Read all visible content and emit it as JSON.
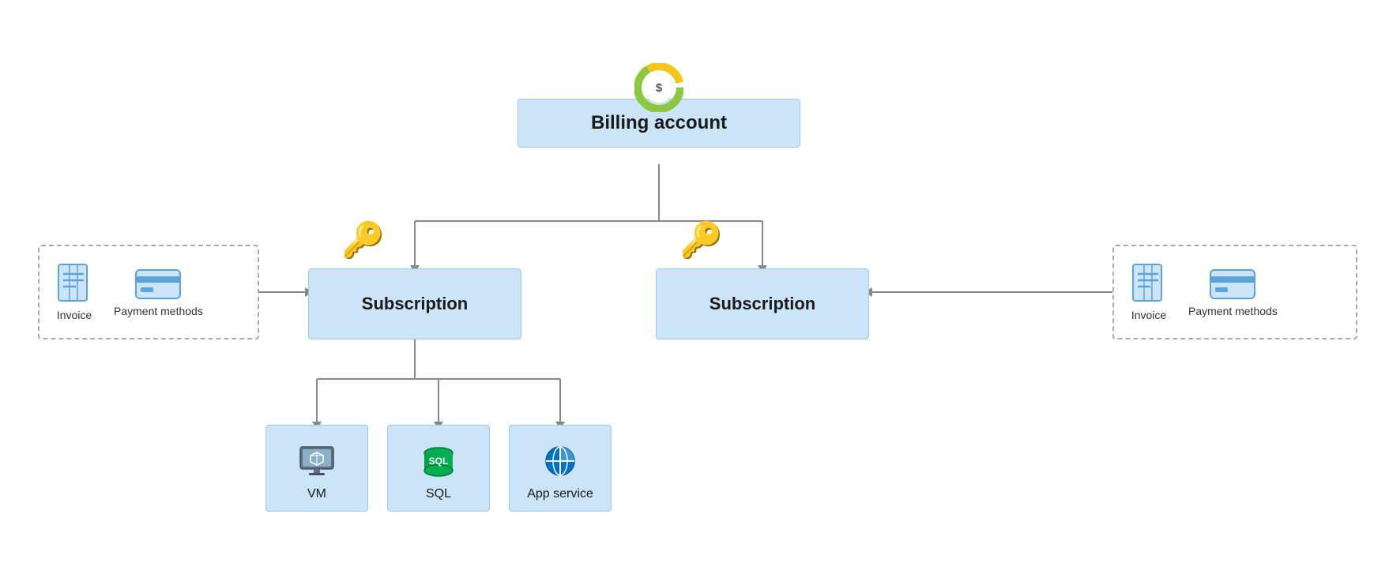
{
  "billing": {
    "label": "Billing account"
  },
  "subscriptions": {
    "left_label": "Subscription",
    "right_label": "Subscription"
  },
  "left_sidebar": {
    "invoice_label": "Invoice",
    "payment_label": "Payment methods"
  },
  "right_sidebar": {
    "invoice_label": "Invoice",
    "payment_label": "Payment methods"
  },
  "resources": {
    "vm_label": "VM",
    "sql_label": "SQL",
    "app_label": "App service"
  },
  "colors": {
    "box_fill": "#cce4f7",
    "box_border": "#9dc8eb",
    "line_color": "#888888"
  }
}
